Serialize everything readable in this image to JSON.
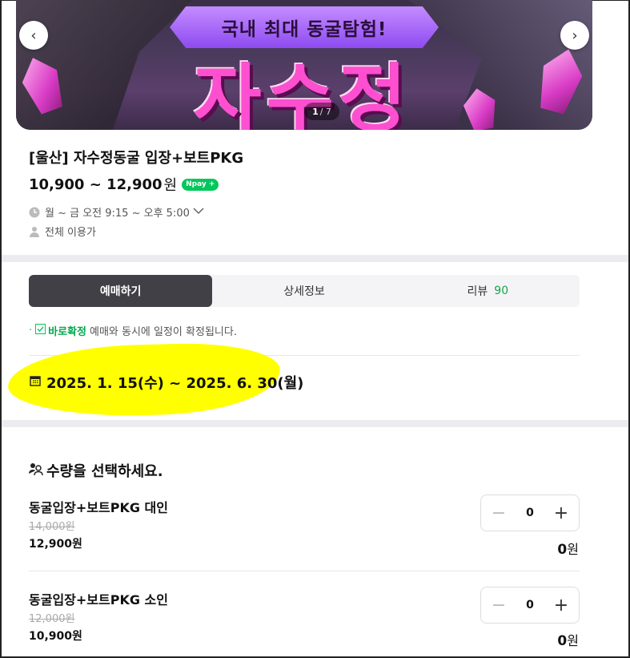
{
  "hero": {
    "ribbon_text": "국내 최대 동굴탐험!",
    "big_text": "자수정",
    "counter_current": "1",
    "counter_total": "/ 7",
    "prev_icon": "chevron-left-icon",
    "next_icon": "chevron-right-icon"
  },
  "product": {
    "title": "[울산] 자수정동굴 입장+보트PKG",
    "price": "10,900 ~ 12,900",
    "price_unit": "원",
    "npay_badge": "Npay +",
    "hours": "월 ~ 금 오전 9:15 ~ 오후 5:00",
    "audience": "전체 이용가"
  },
  "tabs": [
    {
      "label": "예매하기",
      "active": true
    },
    {
      "label": "상세정보",
      "active": false
    },
    {
      "label": "리뷰",
      "count": "90",
      "active": false
    }
  ],
  "confirm": {
    "strong": "바로확정",
    "text": "예매와 동시에 일정이 확정됩니다."
  },
  "period": {
    "text": "2025. 1. 15(수) ~ 2025. 6. 30(월)"
  },
  "quantity": {
    "header": "수량을 선택하세요.",
    "options": [
      {
        "name": "동굴입장+보트PKG 대인",
        "original_price": "14,000원",
        "price": "12,900원",
        "count": "0",
        "total": "0",
        "total_unit": "원"
      },
      {
        "name": "동굴입장+보트PKG 소인",
        "original_price": "12,000원",
        "price": "10,900원",
        "count": "0",
        "total": "0",
        "total_unit": "원"
      }
    ]
  },
  "colors": {
    "accent_green": "#03c75a",
    "active_tab_bg": "#424047",
    "highlight": "#ffff00"
  }
}
